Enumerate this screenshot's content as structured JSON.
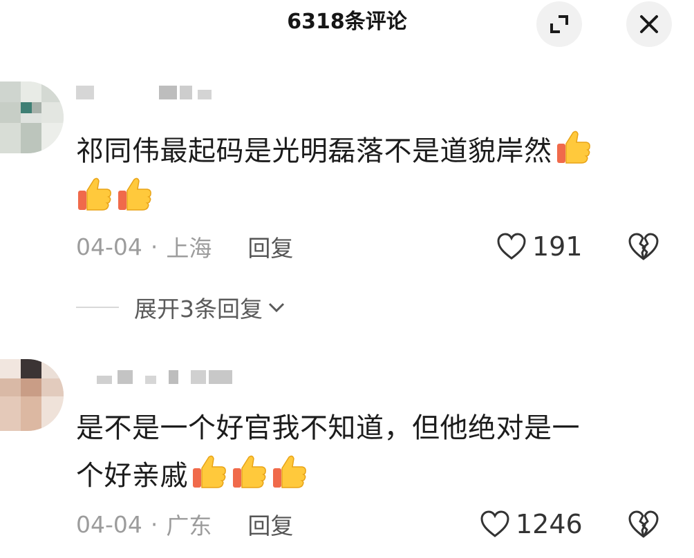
{
  "header": {
    "title": "6318条评论"
  },
  "comments": [
    {
      "text_line1": "祁同伟最起码是光明磊落不是道貌岸然",
      "date": "04-04",
      "location": "上海",
      "reply_label": "回复",
      "likes": "191",
      "emoji_count": 3,
      "expand_replies_label": "展开3条回复"
    },
    {
      "text_line1": "是不是一个好官我不知道，但他绝对是一",
      "text_line2": "个好亲戚",
      "date": "04-04",
      "location": "广东",
      "reply_label": "回复",
      "likes": "1246",
      "emoji_count": 3
    }
  ],
  "colors": {
    "thumb_yellow": "#FFC93C",
    "thumb_cuff": "#F06A4B",
    "meta_grey": "#9c9c9c"
  },
  "icons": {
    "expand": "expand-corner-icon",
    "close": "close-icon",
    "like": "heart-outline-icon",
    "dislike": "broken-heart-icon",
    "chevron": "chevron-down-icon"
  }
}
